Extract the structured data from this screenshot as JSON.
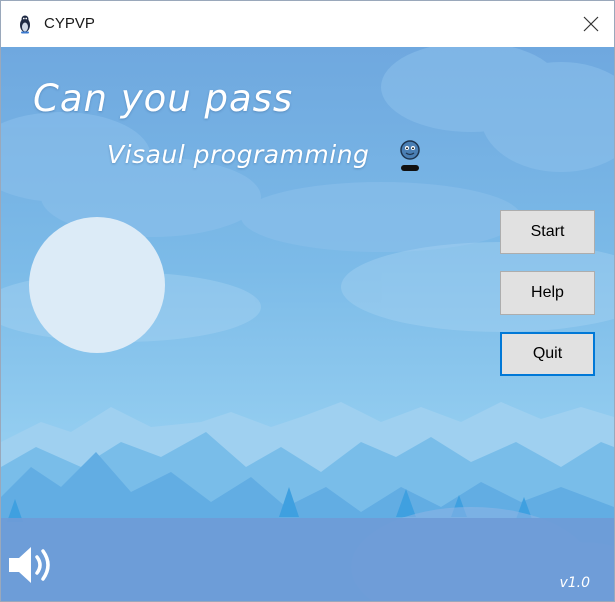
{
  "window": {
    "title": "CYPVP",
    "app_icon": "penguin-icon",
    "close_icon": "close-icon"
  },
  "hero": {
    "headline": "Can you pass",
    "subtitle": "Visaul programming",
    "mascot_icon": "mascot-icon"
  },
  "menu": {
    "start_label": "Start",
    "help_label": "Help",
    "quit_label": "Quit",
    "focused": "Quit"
  },
  "footer": {
    "sound_icon": "speaker-icon",
    "version": "v1.0"
  },
  "colors": {
    "sky_top": "#6fa8df",
    "sky_bottom": "#93cdf0",
    "mountain": "#6bb3e3",
    "button_face": "#e1e1e1",
    "focus_border": "#0078d7",
    "bottom_bar": "#6e9bd7"
  }
}
